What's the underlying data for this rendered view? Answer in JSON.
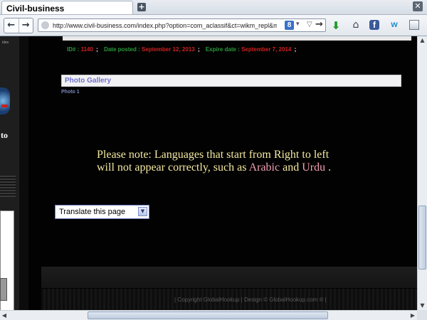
{
  "browser": {
    "tab_title": "Civil-business",
    "new_tab_symbol": "+",
    "close_symbol": "✕",
    "back_symbol": "←",
    "forward_symbol": "→",
    "url": "http://www.civil-business.com/index.php?option=com_aclassif&ct=wikm_repl&md=submitac",
    "search_engine_glyph": "8",
    "go_symbol": "→",
    "toolbar_icons": [
      "download-icon",
      "home-icon",
      "facebook-icon",
      "w-icon",
      "menu-icon"
    ],
    "fb_glyph": "f",
    "w_glyph": "w"
  },
  "listing": {
    "id_label": "ID# :",
    "id_value": "1140",
    "posted_label": "Date posted :",
    "posted_value": "September 12, 2013",
    "expire_label": "Expire date :",
    "expire_value": "September 7, 2014",
    "separator": ";"
  },
  "gallery": {
    "title": "Photo Gallery",
    "photo_label": "Photo 1"
  },
  "note": {
    "line1": "Please note: Languages that start from Right to left",
    "line2_prefix": "will not appear correctly, such as",
    "lang1": "Arabic",
    "and_word": "and",
    "lang2": "Urdu",
    "end": "."
  },
  "translate": {
    "label": "Translate this page"
  },
  "sidebar": {
    "small_text": "ides",
    "partial_word": "to"
  },
  "footer": {
    "text": "| Copyright GlobalHookup | Design © GlobalHookup.com ® |"
  },
  "colors": {
    "label_green": "#2a9a3a",
    "value_red": "#d02020",
    "note_yellow": "#f4e9a0",
    "lang_pink": "#f0a0b0",
    "gallery_blue": "#7070cc"
  }
}
